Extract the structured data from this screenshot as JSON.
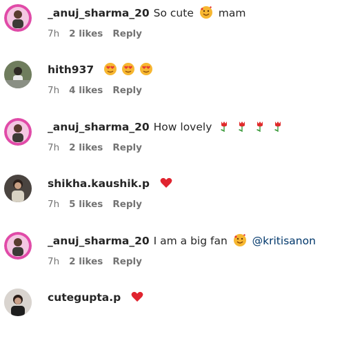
{
  "comments": [
    {
      "username": "_anuj_sharma_20",
      "text": "So cute",
      "emojis_after": [
        "smiling-face-with-hearts"
      ],
      "trailing_text": "mam",
      "time": "7h",
      "likes": "2 likes",
      "reply": "Reply"
    },
    {
      "username": "hith937",
      "text": "",
      "emojis_after": [
        "heart-eyes",
        "heart-eyes",
        "heart-eyes"
      ],
      "trailing_text": "",
      "time": "7h",
      "likes": "4 likes",
      "reply": "Reply"
    },
    {
      "username": "_anuj_sharma_20",
      "text": "How lovely",
      "emojis_after": [
        "tulip",
        "tulip",
        "tulip",
        "tulip"
      ],
      "trailing_text": "",
      "time": "7h",
      "likes": "2 likes",
      "reply": "Reply"
    },
    {
      "username": "shikha.kaushik.p",
      "text": "",
      "emojis_after": [
        "red-heart"
      ],
      "trailing_text": "",
      "time": "7h",
      "likes": "5 likes",
      "reply": "Reply"
    },
    {
      "username": "_anuj_sharma_20",
      "text": "I am a big fan",
      "emojis_after": [
        "smiling-face-with-hearts"
      ],
      "trailing_text": "",
      "mention": "@kritisanon",
      "time": "7h",
      "likes": "2 likes",
      "reply": "Reply"
    },
    {
      "username": "cutegupta.p",
      "text": "",
      "emojis_after": [
        "red-heart"
      ],
      "trailing_text": ""
    }
  ]
}
